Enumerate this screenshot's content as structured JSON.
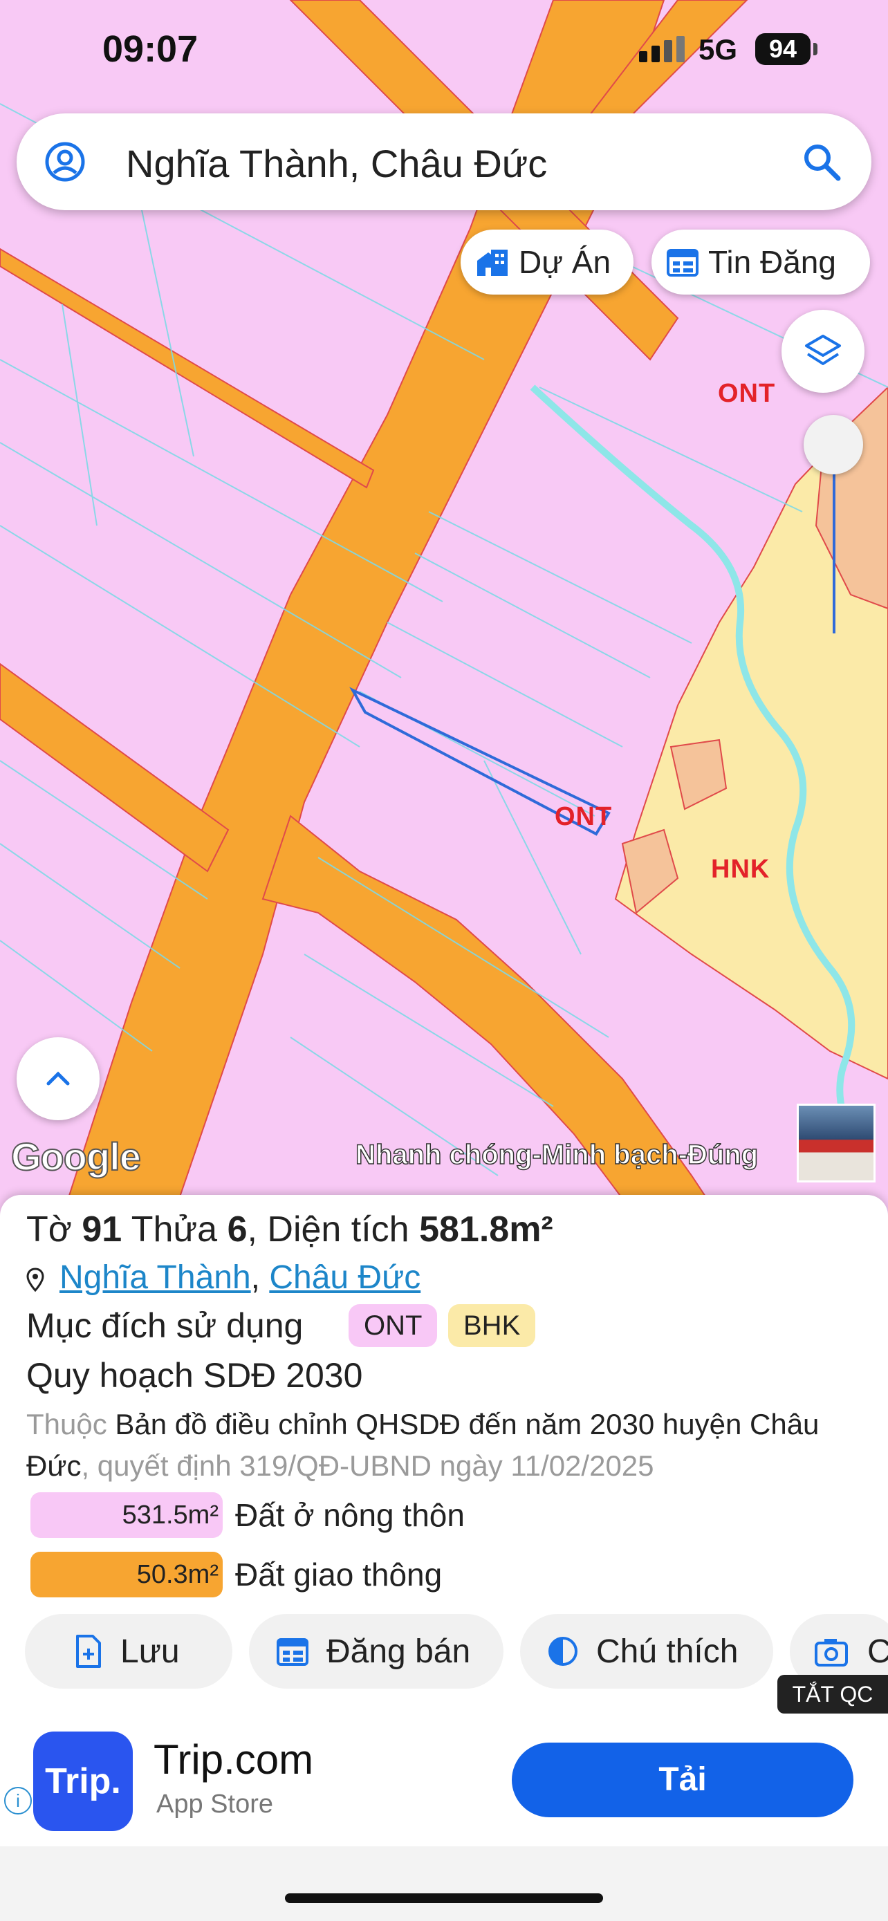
{
  "status": {
    "time": "09:07",
    "network": "5G",
    "battery": "94"
  },
  "search": {
    "query": "Nghĩa Thành, Châu Đức"
  },
  "chips": {
    "projects": "Dự Án",
    "listings": "Tin Đăng"
  },
  "map": {
    "labels": {
      "ont_top": "ONT",
      "ont_parcel": "ONT",
      "hnk": "HNK"
    },
    "google": "Google",
    "banner": "Nhanh chóng-Minh bạch-Đúng"
  },
  "parcel": {
    "to_label": "Tờ",
    "to_value": "91",
    "thua_label": "Thửa",
    "thua_value": "6",
    "area_label": "Diện tích",
    "area_value": "581.8m²",
    "ward": "Nghĩa Thành",
    "separator": ",",
    "district": "Châu Đức",
    "purpose_label": "Mục đích sử dụng",
    "tags": [
      "ONT",
      "BHK"
    ],
    "plan_title": "Quy hoạch SDĐ 2030",
    "desc_prefix": "Thuộc",
    "desc_main": "Bản đồ điều chỉnh QHSDĐ đến năm 2030 huyện Châu Đức",
    "desc_suffix": ", quyết định 319/QĐ-UBND ngày 11/02/2025",
    "areas": [
      {
        "value": "531.5m²",
        "label": "Đất ở nông thôn",
        "color": "#f8c8f6"
      },
      {
        "value": "50.3m²",
        "label": "Đất giao thông",
        "color": "#f7a531"
      }
    ]
  },
  "actions": {
    "save": "Lưu",
    "post": "Đăng bán",
    "legend": "Chú thích",
    "capture": "C"
  },
  "ad": {
    "close_label": "TẮT QC",
    "logo": "Trip.",
    "app_name": "Trip.com",
    "store": "App Store",
    "install": "Tải"
  },
  "colors": {
    "land_ont": "#f8c8f6",
    "road": "#f7a531",
    "hnk": "#fbeaa8",
    "accent": "#1262e8"
  }
}
